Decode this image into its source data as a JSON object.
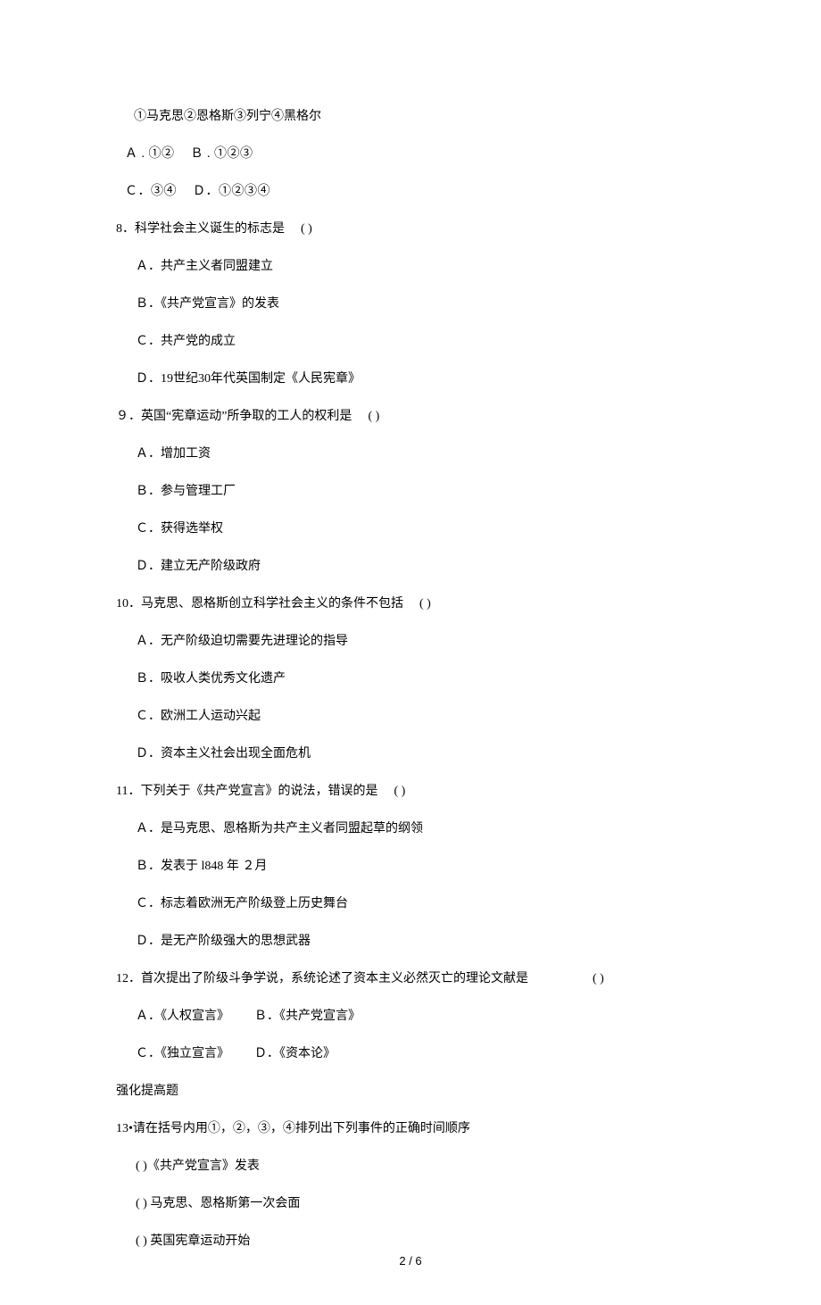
{
  "l1": "①马克思②恩格斯③列宁④黑格尔",
  "l2_a": "Ａ . ①②",
  "l2_b": "Ｂ . ①②③",
  "l3_c": "Ｃ．③④",
  "l3_d": "Ｄ．①②③④",
  "q8": {
    "stem": "8．科学社会主义诞生的标志是",
    "paren": "( )"
  },
  "q8a": "Ａ．共产主义者同盟建立",
  "q8b": "Ｂ．《共产党宣言》的发表",
  "q8c": "Ｃ．共产党的成立",
  "q8d": "Ｄ．19世纪30年代英国制定《人民宪章》",
  "q9": {
    "stem": "９．英国“宪章运动”所争取的工人的权利是",
    "paren": "( )"
  },
  "q9a": "Ａ．增加工资",
  "q9b": "Ｂ．参与管理工厂",
  "q9c": "Ｃ．获得选举权",
  "q9d": "Ｄ．建立无产阶级政府",
  "q10": {
    "stem": "10．马克思、恩格斯创立科学社会主义的条件不包括",
    "paren": "( )"
  },
  "q10a": "Ａ．无产阶级迫切需要先进理论的指导",
  "q10b": "Ｂ．吸收人类优秀文化遗产",
  "q10c": "Ｃ．欧洲工人运动兴起",
  "q10d": "Ｄ．资本主义社会出现全面危机",
  "q11": {
    "stem": "11．下列关于《共产党宣言》的说法，错误的是",
    "paren": "( )"
  },
  "q11a": "Ａ．是马克思、恩格斯为共产主义者同盟起草的纲领",
  "q11b": "Ｂ．发表于 l848 年 ２月",
  "q11c": "Ｃ．标志着欧洲无产阶级登上历史舞台",
  "q11d": "Ｄ．是无产阶级强大的思想武器",
  "q12": {
    "stem": "12．首次提出了阶级斗争学说，系统论述了资本主义必然灭亡的理论文献是",
    "paren": "( )"
  },
  "q12a": "Ａ．《人权宣言》",
  "q12b": "Ｂ．《共产党宣言》",
  "q12c": "Ｃ．《独立宣言》",
  "q12d": "Ｄ．《资本论》",
  "section": "强化提高题",
  "q13": "13•请在括号内用①，②，③，④排列出下列事件的正确时间顺序",
  "q13a": "( )《共产党宣言》发表",
  "q13b": "( ) 马克思、恩格斯第一次会面",
  "q13c": "( ) 英国宪章运动开始",
  "pageNumber": "2 / 6"
}
